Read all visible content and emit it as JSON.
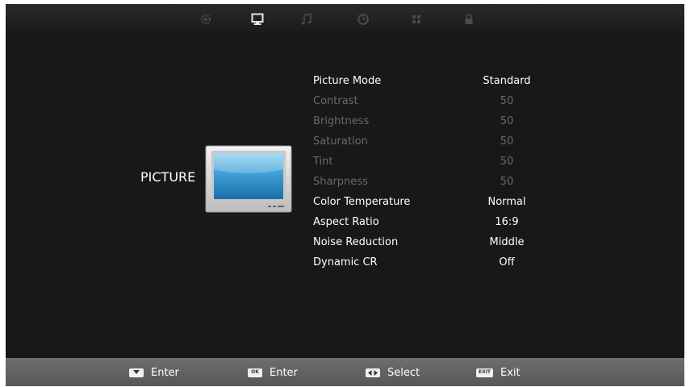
{
  "tabs": [
    {
      "id": "tab-setup",
      "icon": "gear-icon",
      "active": false
    },
    {
      "id": "tab-picture",
      "icon": "monitor-icon",
      "active": true
    },
    {
      "id": "tab-sound",
      "icon": "music-note-icon",
      "active": false
    },
    {
      "id": "tab-time",
      "icon": "clock-icon",
      "active": false
    },
    {
      "id": "tab-option",
      "icon": "grid-icon",
      "active": false
    },
    {
      "id": "tab-lock",
      "icon": "lock-icon",
      "active": false
    }
  ],
  "section": {
    "title": "PICTURE",
    "image": "tv-icon"
  },
  "menu": [
    {
      "label": "Picture Mode",
      "value": "Standard",
      "enabled": true
    },
    {
      "label": "Contrast",
      "value": "50",
      "enabled": false
    },
    {
      "label": "Brightness",
      "value": "50",
      "enabled": false
    },
    {
      "label": "Saturation",
      "value": "50",
      "enabled": false
    },
    {
      "label": "Tint",
      "value": "50",
      "enabled": false
    },
    {
      "label": "Sharpness",
      "value": "50",
      "enabled": false
    },
    {
      "label": "Color Temperature",
      "value": "Normal",
      "enabled": true
    },
    {
      "label": "Aspect Ratio",
      "value": "16:9",
      "enabled": true
    },
    {
      "label": "Noise Reduction",
      "value": "Middle",
      "enabled": true
    },
    {
      "label": "Dynamic CR",
      "value": "Off",
      "enabled": true
    }
  ],
  "hints": [
    {
      "key": "down-arrow-key",
      "key_text": "",
      "label": "Enter"
    },
    {
      "key": "ok-key",
      "key_text": "OK",
      "label": "Enter"
    },
    {
      "key": "left-right-key",
      "key_text": "",
      "label": "Select"
    },
    {
      "key": "exit-key",
      "key_text": "EXIT",
      "label": "Exit"
    }
  ],
  "colors": {
    "background": "#181818",
    "text_enabled": "#ffffff",
    "text_disabled": "#6a6a6a",
    "bottom_bar": "#626262",
    "screen_blue": "#2f8fc7"
  }
}
